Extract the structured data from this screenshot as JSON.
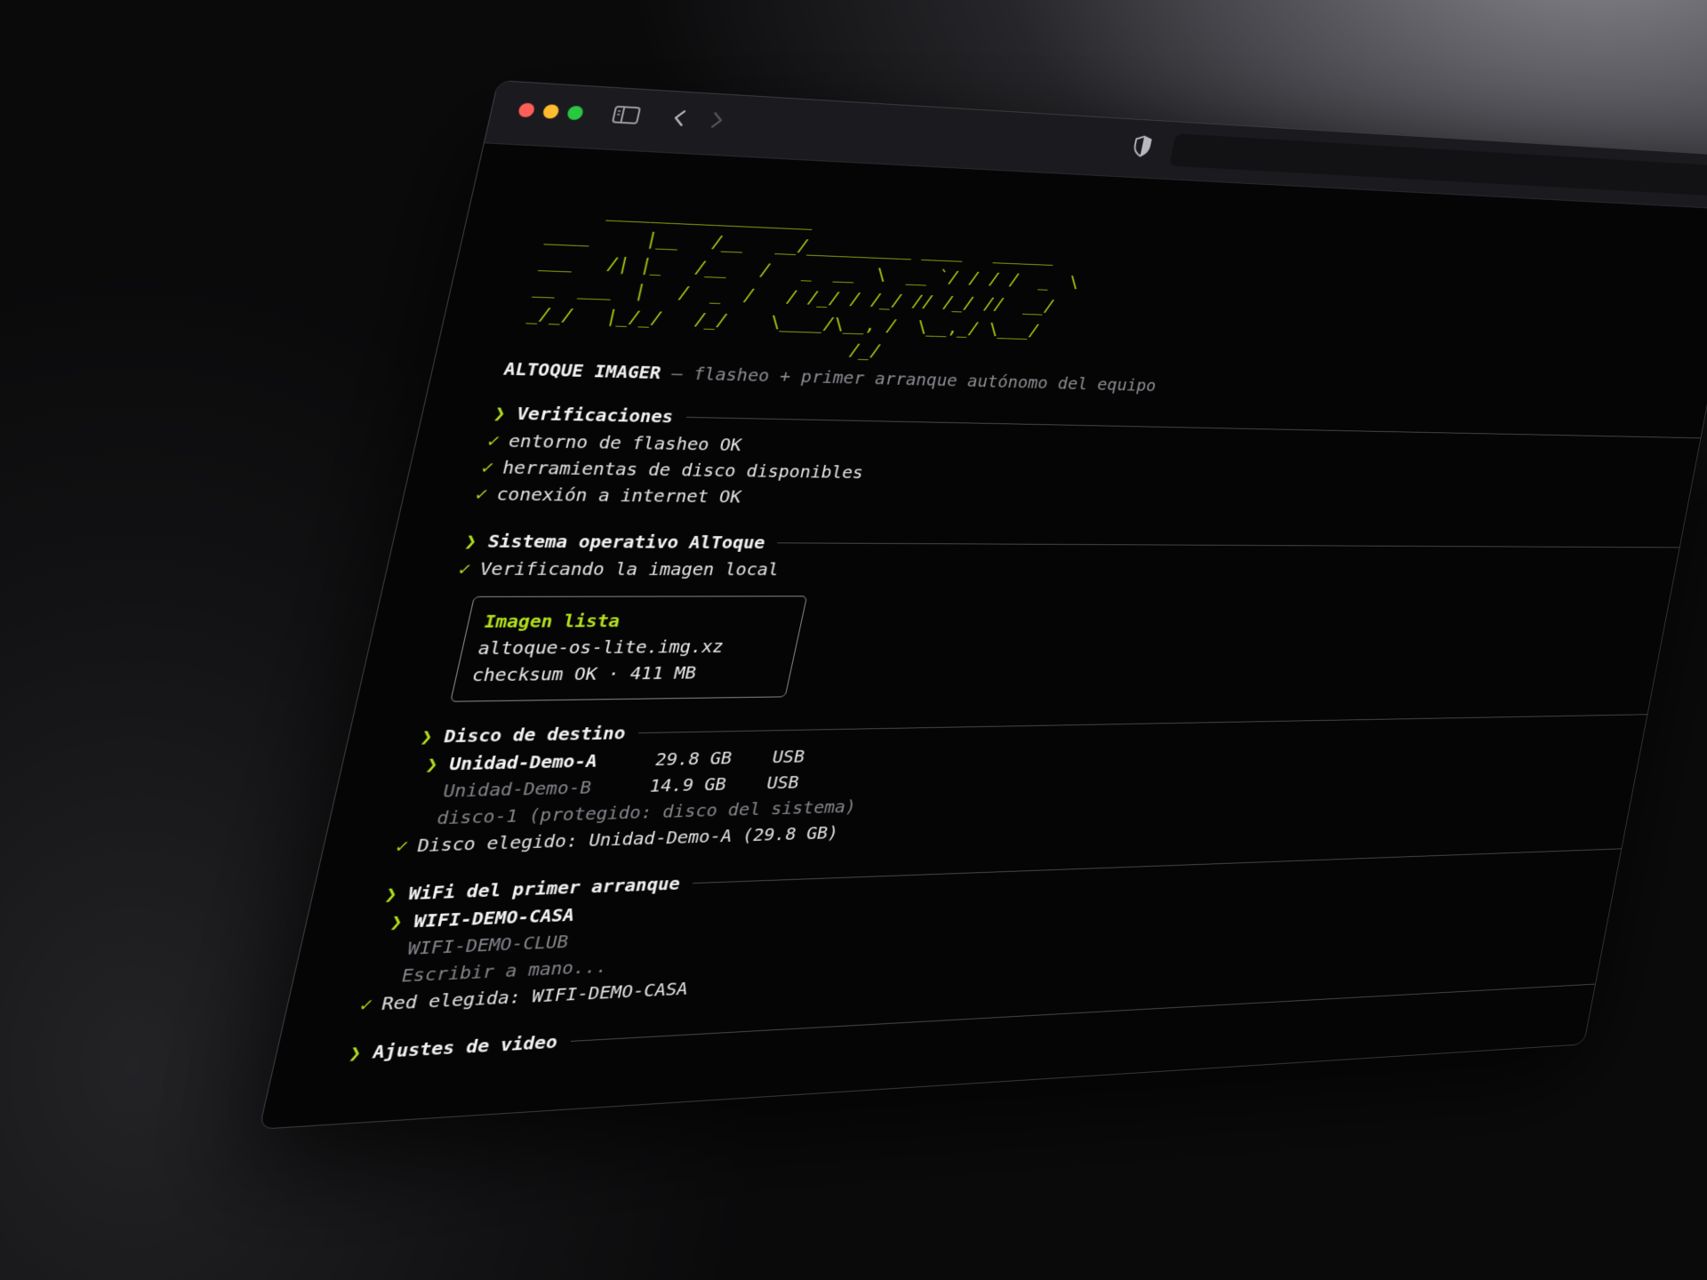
{
  "window": {
    "controls": [
      "close",
      "minimize",
      "zoom"
    ],
    "icons": [
      "sidebar-icon",
      "back-icon",
      "forward-icon",
      "shield-icon"
    ]
  },
  "banner": {
    "ascii": "      ___________________\n ____     |__   /__   __/__________ ____   ______\n ___   /| |_   /__   /   _  __  \\  __ `/ / / /  _  \\\n __  ___  |   /  _  /   / /_/ / /_/ // /_/ //  __/\n _/_/   |_/_/   /_/    \\____/\\__, /  \\__,_/ \\___/\n                               /_/",
    "app_name": "ALTOQUE IMAGER",
    "tagline": " — flasheo + primer arranque autónomo del equipo"
  },
  "sections": {
    "checks": {
      "title": "Verificaciones",
      "items": [
        "entorno de flasheo OK",
        "herramientas de disco disponibles",
        "conexión a internet OK"
      ]
    },
    "os": {
      "title": "Sistema operativo AlToque",
      "status": "Verificando la imagen local",
      "box": {
        "title": "Imagen lista",
        "file": "altoque-os-lite.img.xz",
        "meta": "checksum OK · 411 MB"
      }
    },
    "disk": {
      "title": "Disco de destino",
      "options": [
        {
          "name": "Unidad-Demo-A",
          "size": "29.8 GB",
          "bus": "USB"
        },
        {
          "name": "Unidad-Demo-B",
          "size": "14.9 GB",
          "bus": "USB"
        },
        {
          "name": "disco-1 (protegido: disco del sistema)"
        }
      ],
      "chosen": "Disco elegido: Unidad-Demo-A (29.8 GB)"
    },
    "wifi": {
      "title": "WiFi del primer arranque",
      "options": [
        "WIFI-DEMO-CASA",
        "WIFI-DEMO-CLUB",
        "Escribir a mano..."
      ],
      "chosen": "Red elegida: WIFI-DEMO-CASA"
    },
    "video": {
      "title": "Ajustes de video"
    }
  },
  "symbols": {
    "chevron": "❯",
    "check": "✓"
  },
  "colors": {
    "accent": "#b4e01a",
    "banner": "#a9d10f",
    "dim": "#85858b"
  }
}
